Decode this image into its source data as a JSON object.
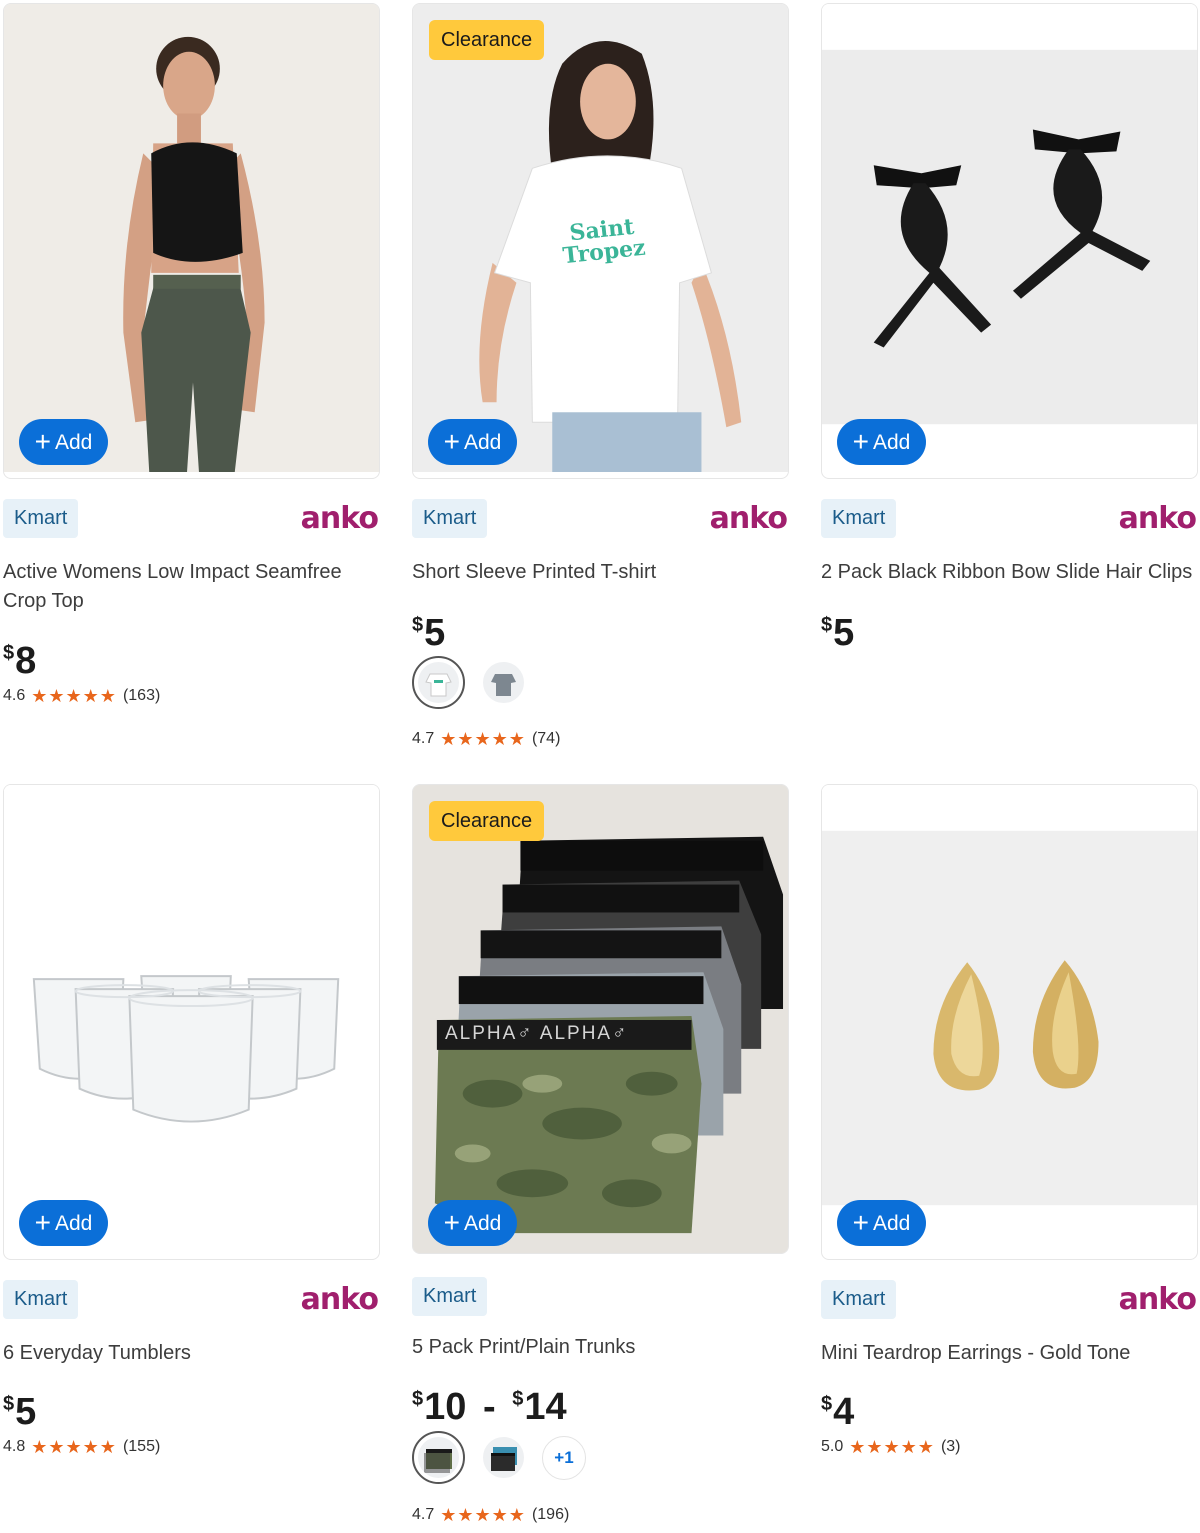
{
  "products": [
    {
      "badge": "",
      "add_label": "Add",
      "store": "Kmart",
      "brand": "anko",
      "title": "Active Womens Low Impact Seamfree Crop Top",
      "price_currency": "$",
      "price": "8",
      "rating": "4.6",
      "stars": "★★★★★",
      "reviews": "(163)",
      "image_icon": "woman-in-activewear-image"
    },
    {
      "badge": "Clearance",
      "add_label": "Add",
      "store": "Kmart",
      "brand": "anko",
      "title": "Short Sleeve Printed T-shirt",
      "price_currency": "$",
      "price": "5",
      "rating": "4.7",
      "stars": "★★★★★",
      "reviews": "(74)",
      "print_text": "Saint Tropez",
      "image_icon": "woman-in-tshirt-image"
    },
    {
      "badge": "",
      "add_label": "Add",
      "store": "Kmart",
      "brand": "anko",
      "title": "2 Pack Black Ribbon Bow Slide Hair Clips",
      "price_currency": "$",
      "price": "5",
      "image_icon": "black-ribbon-bows-image"
    },
    {
      "badge": "",
      "add_label": "Add",
      "store": "Kmart",
      "brand": "anko",
      "title": "6 Everyday Tumblers",
      "price_currency": "$",
      "price": "5",
      "rating": "4.8",
      "stars": "★★★★★",
      "reviews": "(155)",
      "image_icon": "glass-tumblers-image"
    },
    {
      "badge": "Clearance",
      "add_label": "Add",
      "store": "Kmart",
      "title": "5 Pack Print/Plain Trunks",
      "price_currency": "$",
      "price_low": "10",
      "price_sep": "-",
      "price_high": "14",
      "rating": "4.7",
      "stars": "★★★★★",
      "reviews": "(196)",
      "more_swatches": "+1",
      "waistband_text": "ALPHA♂ ALPHA♂",
      "image_icon": "trunks-stack-image"
    },
    {
      "badge": "",
      "add_label": "Add",
      "store": "Kmart",
      "brand": "anko",
      "title": "Mini Teardrop Earrings - Gold Tone",
      "price_currency": "$",
      "price": "4",
      "rating": "5.0",
      "stars": "★★★★★",
      "reviews": "(3)",
      "image_icon": "gold-earrings-image"
    }
  ],
  "colors": {
    "add_button": "#0b6fd8",
    "clearance_badge": "#ffc93c",
    "store_tag_bg": "#e7f1f8",
    "brand": "#a01f6d",
    "stars": "#e8661c"
  }
}
